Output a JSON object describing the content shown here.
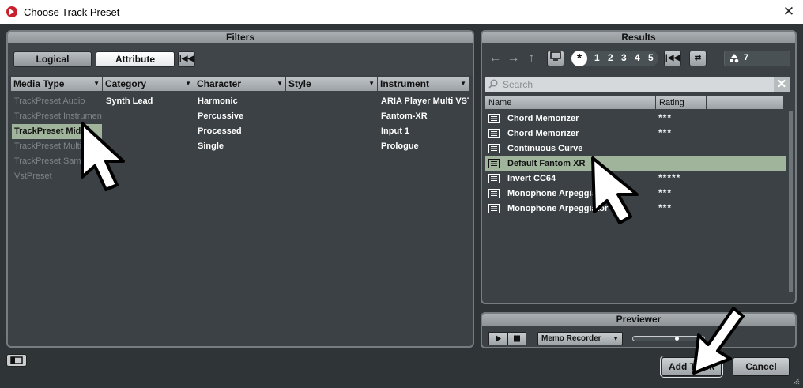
{
  "window": {
    "title": "Choose Track Preset"
  },
  "filters": {
    "header": "Filters",
    "logical_label": "Logical",
    "attribute_label": "Attribute",
    "columns": [
      {
        "label": "Media Type",
        "items": [
          {
            "text": "TrackPreset Audio",
            "state": "dim"
          },
          {
            "text": "TrackPreset Instrument",
            "state": "dim"
          },
          {
            "text": "TrackPreset Midi",
            "state": "selected"
          },
          {
            "text": "TrackPreset Multi",
            "state": "dim"
          },
          {
            "text": "TrackPreset Sample",
            "state": "dim"
          },
          {
            "text": "VstPreset",
            "state": "dim"
          }
        ]
      },
      {
        "label": "Category",
        "items": [
          {
            "text": "Synth Lead",
            "state": "normal"
          }
        ]
      },
      {
        "label": "Character",
        "items": [
          {
            "text": "Harmonic",
            "state": "normal"
          },
          {
            "text": "Percussive",
            "state": "normal"
          },
          {
            "text": "Processed",
            "state": "normal"
          },
          {
            "text": "Single",
            "state": "normal"
          }
        ]
      },
      {
        "label": "Style",
        "items": []
      },
      {
        "label": "Instrument",
        "items": [
          {
            "text": "ARIA Player Multi VST",
            "state": "normal"
          },
          {
            "text": "Fantom-XR",
            "state": "normal"
          },
          {
            "text": "Input 1",
            "state": "normal"
          },
          {
            "text": "Prologue",
            "state": "normal"
          }
        ]
      }
    ]
  },
  "results": {
    "header": "Results",
    "rating_filter": [
      "*",
      "1",
      "2",
      "3",
      "4",
      "5"
    ],
    "count": "7",
    "search_placeholder": "Search",
    "col_name": "Name",
    "col_rating": "Rating",
    "rows": [
      {
        "name": "Chord Memorizer",
        "rating": "***",
        "selected": false
      },
      {
        "name": "Chord Memorizer",
        "rating": "***",
        "selected": false
      },
      {
        "name": "Continuous Curve",
        "rating": "",
        "selected": false
      },
      {
        "name": "Default Fantom XR",
        "rating": "",
        "selected": true
      },
      {
        "name": "Invert CC64",
        "rating": "*****",
        "selected": false
      },
      {
        "name": "Monophone Arpeggiator",
        "rating": "***",
        "selected": false
      },
      {
        "name": "Monophone Arpeggiator",
        "rating": "***",
        "selected": false
      }
    ]
  },
  "previewer": {
    "header": "Previewer",
    "device": "Memo Recorder",
    "volume_fraction": 0.62
  },
  "buttons": {
    "add_track": "Add Track",
    "cancel": "Cancel"
  }
}
